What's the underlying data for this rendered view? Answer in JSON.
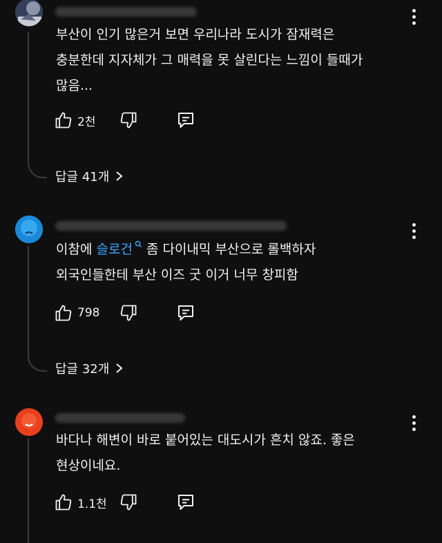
{
  "comments": [
    {
      "text": "부산이 인기 많은거 보면 우리나라 도시가 잠재력은\n충분한데 지자체가 그 매력을 못 살린다는 느낌이 들때가\n많음...",
      "likes": "2천",
      "replies_label": "답글 41개",
      "avatar_color": "#4a5a75"
    },
    {
      "text_before": "이참에 ",
      "link_text": "슬로건",
      "text_after": " 좀 다이내믹 부산으로 롤백하자\n외국인들한테 부산 이즈 굿 이거 너무 창피함",
      "likes": "798",
      "replies_label": "답글 32개",
      "avatar_color": "#1a8ad8"
    },
    {
      "text": "바다나 해변이 바로 붙어있는 대도시가 흔치 않죠. 좋은\n현상이네요.",
      "likes": "1.1천",
      "avatar_color": "#e8401c"
    }
  ],
  "colors": {
    "background": "#0f0f0f",
    "text": "#f1f1f1",
    "link": "#3ea6ff",
    "thread_line": "#3d3d3d"
  },
  "icons": [
    "more-vert-icon",
    "thumb-up-icon",
    "thumb-down-icon",
    "reply-icon",
    "chevron-right-icon",
    "search-icon"
  ]
}
